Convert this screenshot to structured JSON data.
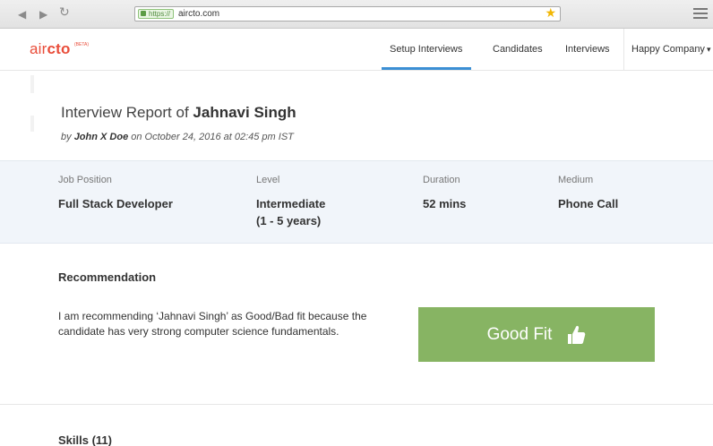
{
  "browser": {
    "back_icon": "back-arrow-icon",
    "forward_icon": "forward-arrow-icon",
    "reload_icon": "reload-icon",
    "https_label": "https://",
    "url": "aircto.com",
    "bookmark_icon": "star-icon",
    "menu_icon": "hamburger-menu-icon",
    "https_color": "#5c9c46",
    "star_color": "#f2b705"
  },
  "header": {
    "logo_prefix": "air",
    "logo_suffix": "cto",
    "logo_badge": "(BETA)",
    "brand_color": "#e94d3a",
    "nav": {
      "setup_interviews": "Setup Interviews",
      "candidates": "Candidates",
      "interviews": "Interviews"
    },
    "active_tab": "Setup Interviews",
    "active_color": "#3b8fd4",
    "company": "Happy Company",
    "company_caret_icon": "chevron-down-icon"
  },
  "report": {
    "title_prefix": "Interview Report of",
    "candidate_name": "Jahnavi Singh",
    "by_prefix": "by",
    "interviewer": "John X Doe",
    "date_text": "on October 24, 2016 at 02:45 pm IST"
  },
  "info": {
    "job_position_label": "Job Position",
    "job_position_value": "Full Stack Developer",
    "level_label": "Level",
    "level_value_line1": "Intermediate",
    "level_value_line2": "(1 - 5 years)",
    "duration_label": "Duration",
    "duration_value": "52 mins",
    "medium_label": "Medium",
    "medium_value": "Phone Call",
    "band_color": "#f1f5fa"
  },
  "recommendation": {
    "title": "Recommendation",
    "text": "I am recommending ‘Jahnavi Singh’ as Good/Bad fit because the candidate has very strong computer science fundamentals.",
    "verdict": "Good Fit",
    "verdict_icon": "thumbs-up-icon",
    "verdict_color": "#87b463"
  },
  "skills": {
    "title": "Skills (11)"
  }
}
